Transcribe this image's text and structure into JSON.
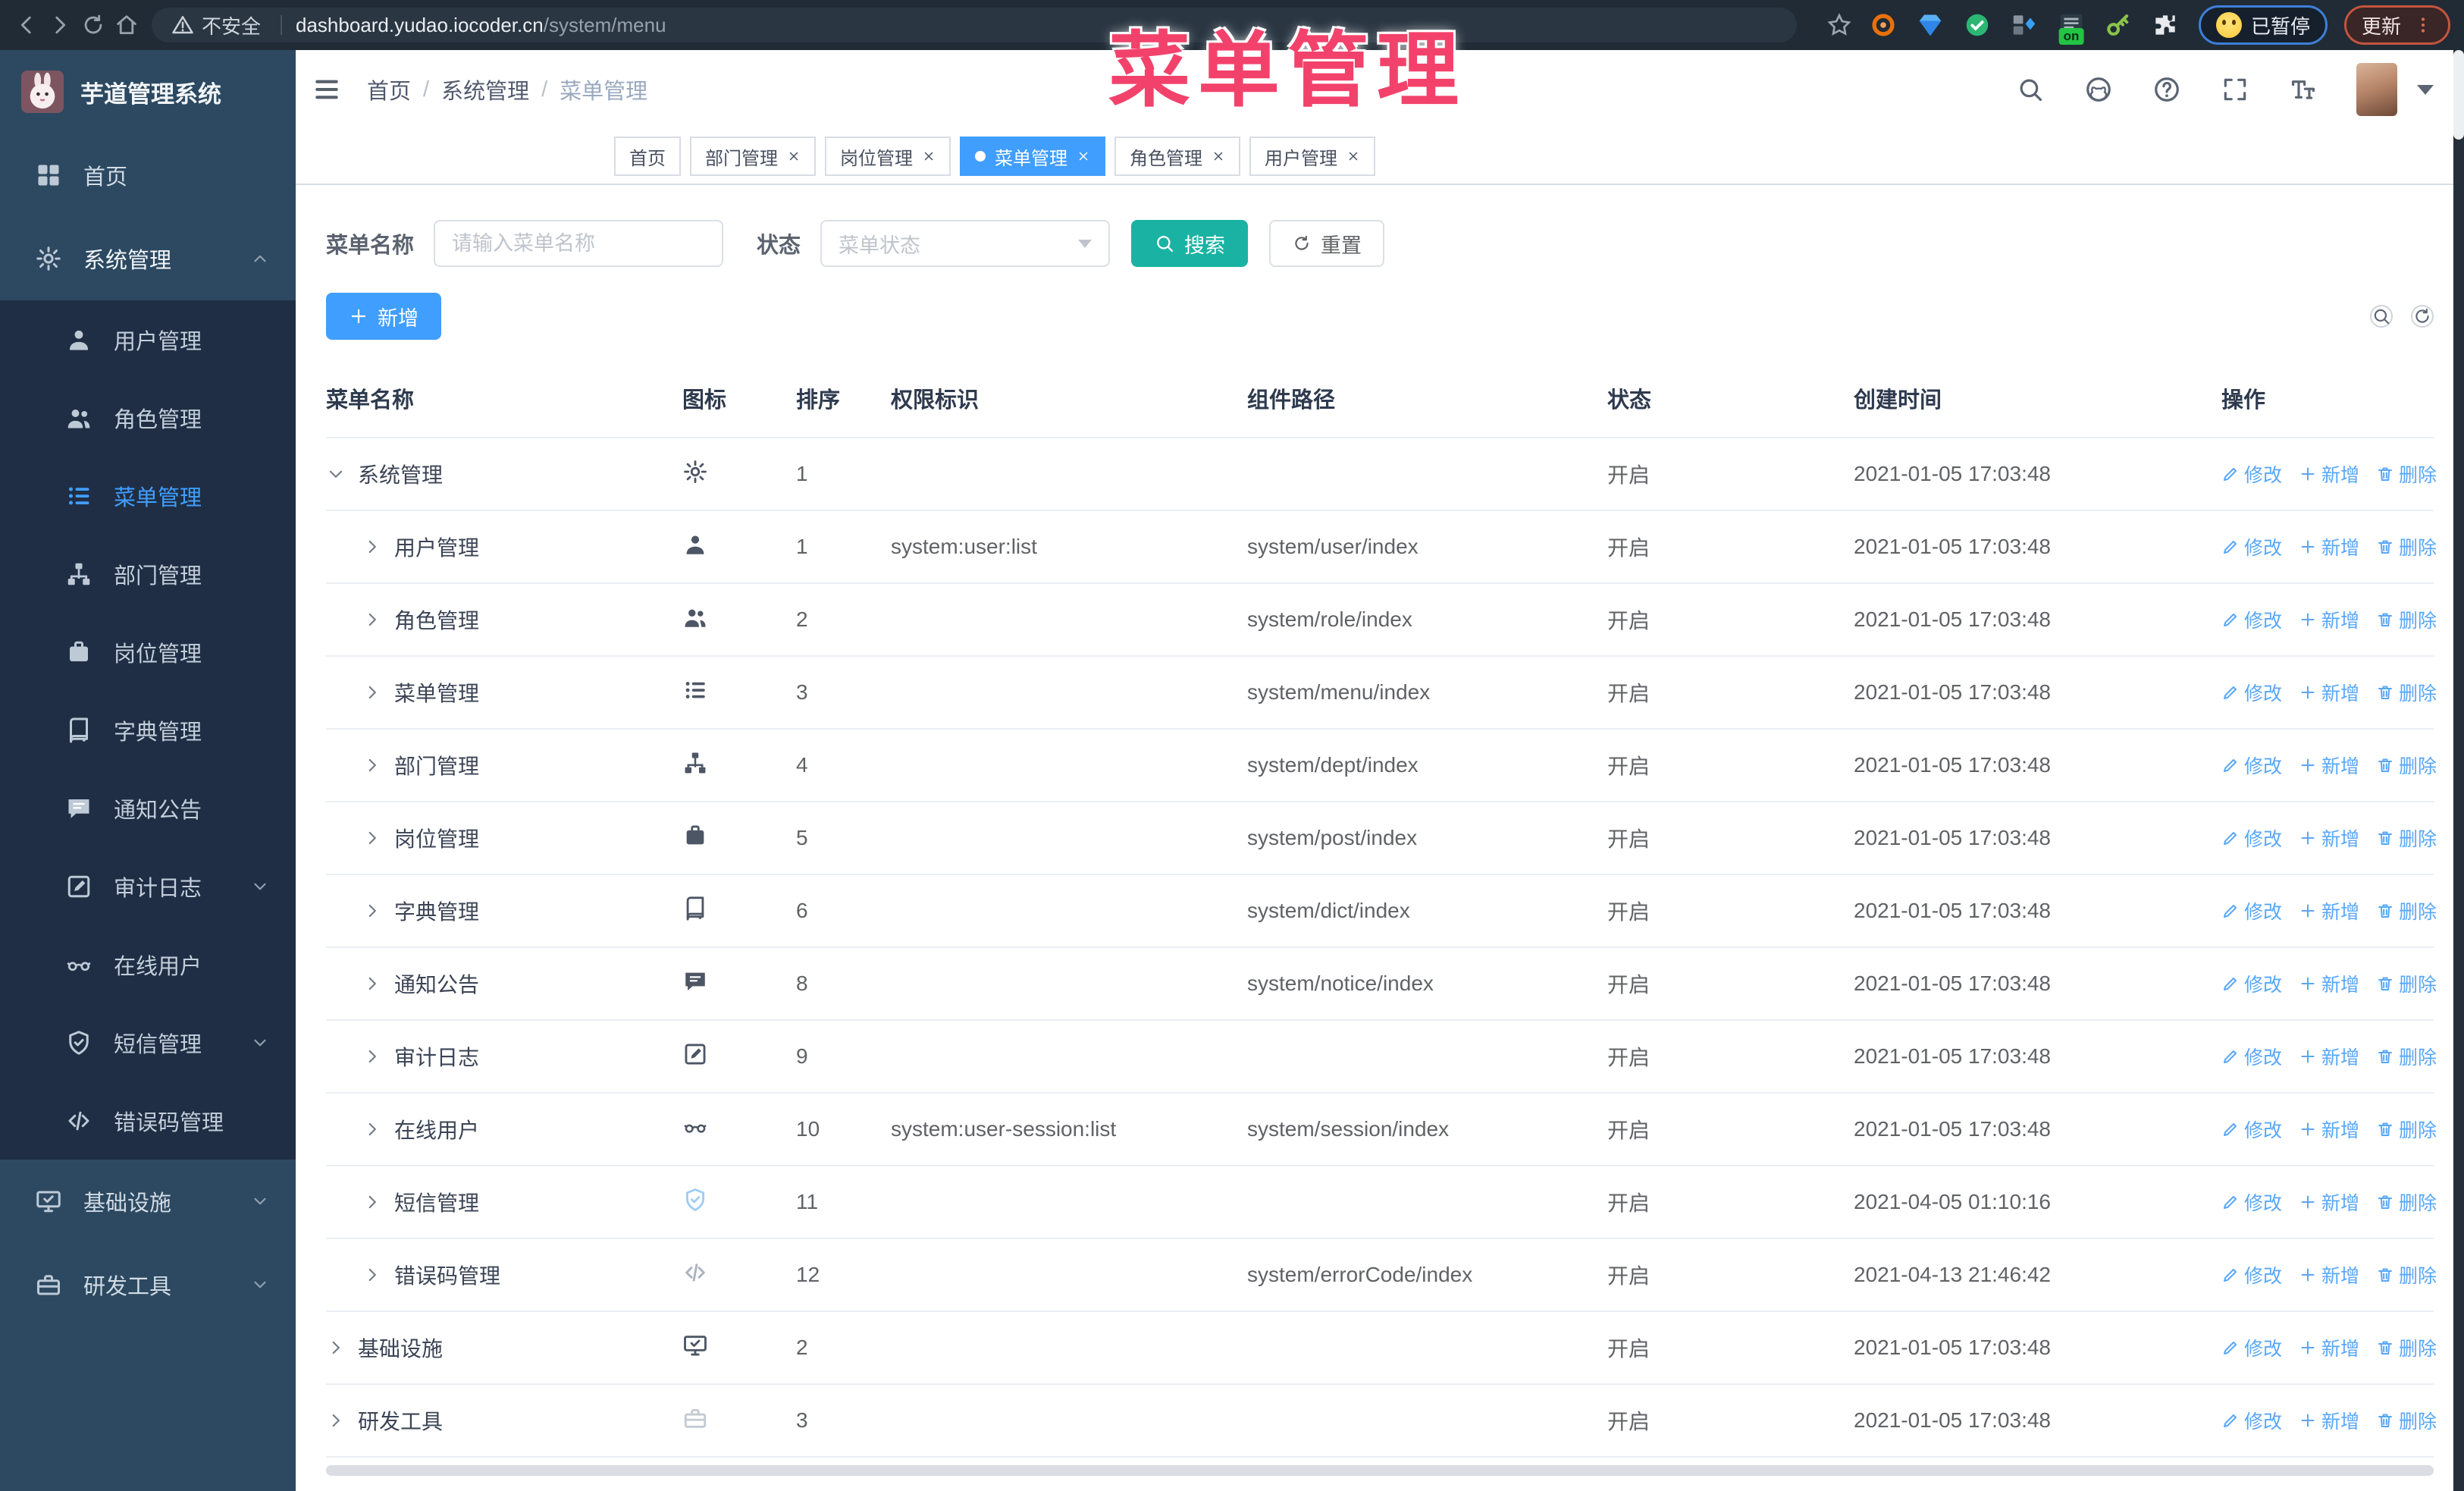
{
  "browser": {
    "security_label": "不安全",
    "url_domain": "dashboard.yudao.iocoder.cn",
    "url_path": "/system/menu",
    "extension_on_badge": "on",
    "paused_button": "已暂停",
    "update_button": "更新",
    "extensions": [
      {
        "name": "extension-orange-ring-icon"
      },
      {
        "name": "extension-gem-icon"
      },
      {
        "name": "extension-green-check-icon"
      },
      {
        "name": "extension-tabs-icon"
      },
      {
        "name": "extension-list-icon",
        "badge": "on"
      },
      {
        "name": "extension-key-icon"
      },
      {
        "name": "extension-puzzle-icon"
      }
    ]
  },
  "watermark": "菜单管理",
  "sidebar": {
    "app_title": "芋道管理系统",
    "top_items": [
      {
        "id": "home",
        "icon": "home",
        "label": "首页"
      },
      {
        "id": "system",
        "icon": "gear",
        "label": "系统管理",
        "caret": "up",
        "open": true
      }
    ],
    "system_children": [
      {
        "id": "user",
        "icon": "user",
        "label": "用户管理"
      },
      {
        "id": "role",
        "icon": "users",
        "label": "角色管理"
      },
      {
        "id": "menu",
        "icon": "menu-tree",
        "label": "菜单管理",
        "active": true
      },
      {
        "id": "dept",
        "icon": "dept",
        "label": "部门管理"
      },
      {
        "id": "post",
        "icon": "post",
        "label": "岗位管理"
      },
      {
        "id": "dict",
        "icon": "dict",
        "label": "字典管理"
      },
      {
        "id": "notice",
        "icon": "notice",
        "label": "通知公告"
      },
      {
        "id": "log",
        "icon": "log",
        "label": "审计日志",
        "caret": "down"
      },
      {
        "id": "online",
        "icon": "online",
        "label": "在线用户"
      },
      {
        "id": "sms",
        "icon": "sms",
        "label": "短信管理",
        "caret": "down"
      },
      {
        "id": "errcode",
        "icon": "errcode",
        "label": "错误码管理"
      }
    ],
    "bottom_items": [
      {
        "id": "infra",
        "icon": "infra",
        "label": "基础设施",
        "caret": "down"
      },
      {
        "id": "tool",
        "icon": "tool",
        "label": "研发工具",
        "caret": "down"
      }
    ]
  },
  "header": {
    "breadcrumb": [
      "首页",
      "系统管理",
      "菜单管理"
    ],
    "breadcrumb_separator": "/",
    "right_icons": [
      "search",
      "github",
      "question",
      "fullscreen",
      "font-size"
    ]
  },
  "tabs": [
    {
      "label": "首页",
      "closable": false
    },
    {
      "label": "部门管理",
      "closable": true
    },
    {
      "label": "岗位管理",
      "closable": true
    },
    {
      "label": "菜单管理",
      "closable": true,
      "active": true
    },
    {
      "label": "角色管理",
      "closable": true
    },
    {
      "label": "用户管理",
      "closable": true
    }
  ],
  "filters": {
    "name_label": "菜单名称",
    "name_placeholder": "请输入菜单名称",
    "status_label": "状态",
    "status_placeholder": "菜单状态",
    "search_button": "搜索",
    "reset_button": "重置"
  },
  "toolbar": {
    "add_button": "新增"
  },
  "table": {
    "columns": [
      "菜单名称",
      "图标",
      "排序",
      "权限标识",
      "组件路径",
      "状态",
      "创建时间",
      "操作"
    ],
    "row_actions": {
      "edit": "修改",
      "add": "新增",
      "delete": "删除"
    },
    "rows": [
      {
        "id": "system",
        "name": "系统管理",
        "level": 0,
        "expanded": true,
        "icon": "gear",
        "sort": "1",
        "perm": "",
        "path": "",
        "status": "开启",
        "time": "2021-01-05 17:03:48"
      },
      {
        "id": "user",
        "name": "用户管理",
        "level": 1,
        "expanded": false,
        "icon": "user",
        "sort": "1",
        "perm": "system:user:list",
        "path": "system/user/index",
        "status": "开启",
        "time": "2021-01-05 17:03:48"
      },
      {
        "id": "role",
        "name": "角色管理",
        "level": 1,
        "expanded": false,
        "icon": "users",
        "sort": "2",
        "perm": "",
        "path": "system/role/index",
        "status": "开启",
        "time": "2021-01-05 17:03:48"
      },
      {
        "id": "menu",
        "name": "菜单管理",
        "level": 1,
        "expanded": false,
        "icon": "menu-tree",
        "sort": "3",
        "perm": "",
        "path": "system/menu/index",
        "status": "开启",
        "time": "2021-01-05 17:03:48"
      },
      {
        "id": "dept",
        "name": "部门管理",
        "level": 1,
        "expanded": false,
        "icon": "dept",
        "sort": "4",
        "perm": "",
        "path": "system/dept/index",
        "status": "开启",
        "time": "2021-01-05 17:03:48"
      },
      {
        "id": "post",
        "name": "岗位管理",
        "level": 1,
        "expanded": false,
        "icon": "post",
        "sort": "5",
        "perm": "",
        "path": "system/post/index",
        "status": "开启",
        "time": "2021-01-05 17:03:48"
      },
      {
        "id": "dict",
        "name": "字典管理",
        "level": 1,
        "expanded": false,
        "icon": "dict",
        "sort": "6",
        "perm": "",
        "path": "system/dict/index",
        "status": "开启",
        "time": "2021-01-05 17:03:48"
      },
      {
        "id": "notice",
        "name": "通知公告",
        "level": 1,
        "expanded": false,
        "icon": "notice",
        "sort": "8",
        "perm": "",
        "path": "system/notice/index",
        "status": "开启",
        "time": "2021-01-05 17:03:48"
      },
      {
        "id": "log",
        "name": "审计日志",
        "level": 1,
        "expanded": false,
        "icon": "log",
        "sort": "9",
        "perm": "",
        "path": "",
        "status": "开启",
        "time": "2021-01-05 17:03:48"
      },
      {
        "id": "online",
        "name": "在线用户",
        "level": 1,
        "expanded": false,
        "icon": "online",
        "sort": "10",
        "perm": "system:user-session:list",
        "path": "system/session/index",
        "status": "开启",
        "time": "2021-01-05 17:03:48"
      },
      {
        "id": "sms",
        "name": "短信管理",
        "level": 1,
        "expanded": false,
        "icon": "sms",
        "icon_color": "#9ecdf5",
        "sort": "11",
        "perm": "",
        "path": "",
        "status": "开启",
        "time": "2021-04-05 01:10:16"
      },
      {
        "id": "errcode",
        "name": "错误码管理",
        "level": 1,
        "expanded": false,
        "icon": "errcode",
        "icon_color": "#aab2bd",
        "sort": "12",
        "perm": "",
        "path": "system/errorCode/index",
        "status": "开启",
        "time": "2021-04-13 21:46:42"
      },
      {
        "id": "infra",
        "name": "基础设施",
        "level": 0,
        "expanded": false,
        "icon": "infra",
        "sort": "2",
        "perm": "",
        "path": "",
        "status": "开启",
        "time": "2021-01-05 17:03:48"
      },
      {
        "id": "tool",
        "name": "研发工具",
        "level": 0,
        "expanded": false,
        "icon": "tool",
        "icon_color": "#c4cad2",
        "sort": "3",
        "perm": "",
        "path": "",
        "status": "开启",
        "time": "2021-01-05 17:03:48"
      }
    ]
  },
  "colors": {
    "primary": "#409eff",
    "search_teal": "#1ab3a3",
    "watermark_pink": "#f2426b",
    "sidebar_bg": "#2c4961",
    "submenu_bg": "#1f2e44",
    "link_blue": "#58a7f8"
  }
}
